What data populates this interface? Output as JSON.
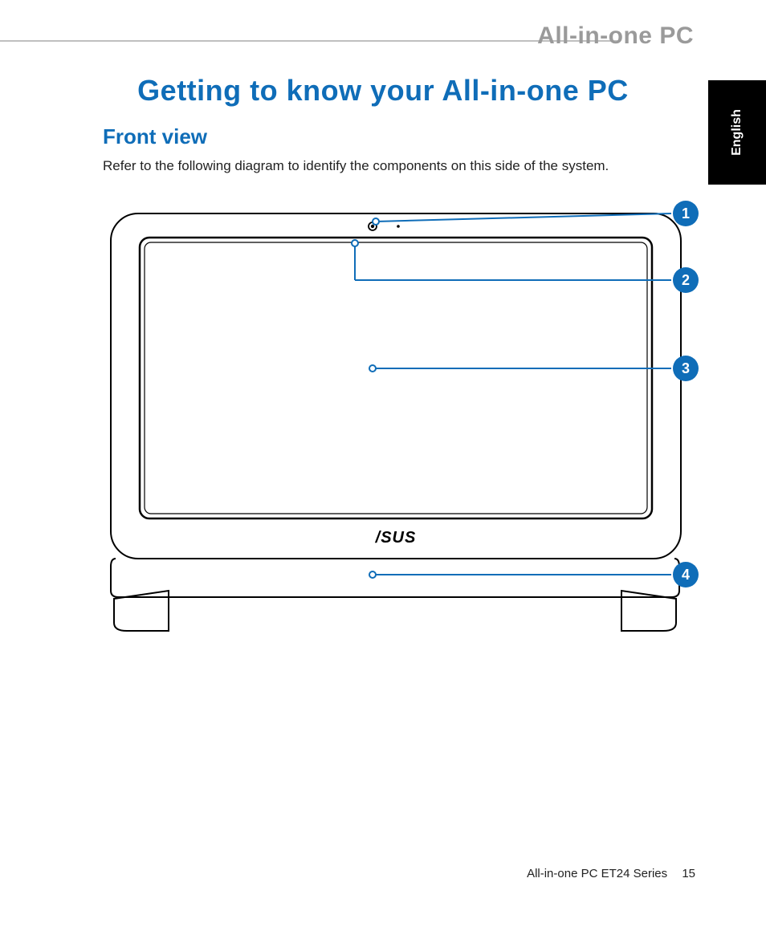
{
  "header": {
    "brand": "All-in-one PC"
  },
  "language_tab": {
    "label": "English"
  },
  "title": "Getting to know your All-in-one PC",
  "subtitle": "Front view",
  "body": "Refer to the following diagram to identify the components on this side of the system.",
  "callouts": {
    "c1": "1",
    "c2": "2",
    "c3": "3",
    "c4": "4"
  },
  "brand_logo_text": "ASUS",
  "footer": {
    "series": "All-in-one PC ET24 Series",
    "page": "15"
  }
}
